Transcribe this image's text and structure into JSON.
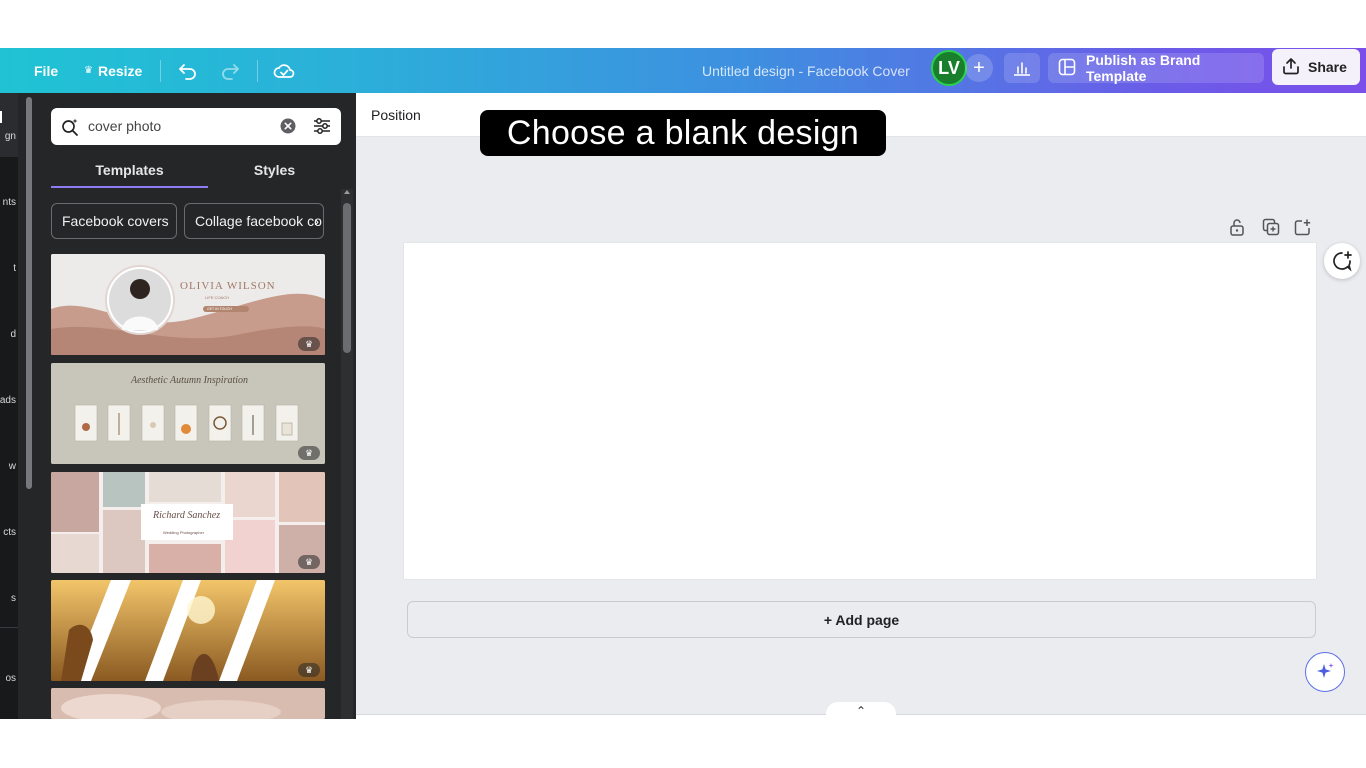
{
  "topbar": {
    "file_label": "File",
    "resize_label": "Resize",
    "design_title": "Untitled design - Facebook Cover",
    "avatar_initials": "LV",
    "add_person_glyph": "+",
    "publish_label": "Publish as Brand Template",
    "share_label": "Share"
  },
  "rail": {
    "items": [
      "gn",
      "nts",
      "t",
      "d",
      "ads",
      "w",
      "cts",
      "s",
      "os"
    ]
  },
  "panel": {
    "search_value": "cover photo",
    "tabs": [
      "Templates",
      "Styles"
    ],
    "active_tab": "Templates",
    "chips": [
      "Facebook covers",
      "Collage facebook co"
    ],
    "templates": [
      {
        "name": "OLIVIA WILSON",
        "subtitle": "LIFE COACH",
        "button": "GET IN TOUCH",
        "premium": true
      },
      {
        "name": "Aesthetic Autumn Inspiration",
        "premium": true
      },
      {
        "name": "Richard Sanchez",
        "subtitle": "Wedding Photographer",
        "premium": true
      },
      {
        "name": "",
        "premium": true
      },
      {
        "name": "",
        "premium": false
      }
    ]
  },
  "editor": {
    "toolbar_label": "Position",
    "callout_text": "Choose a blank design",
    "add_page_label": "+ Add page"
  },
  "colors": {
    "topbar_start": "#1fc3d4",
    "topbar_end": "#7b4fea",
    "panel_bg": "#252627",
    "workspace_bg": "#ebecf0",
    "tab_accent": "#8b7cf6",
    "avatar_bg": "#1a7f2c"
  },
  "icons": [
    "crown-icon",
    "undo-icon",
    "redo-icon",
    "cloud-save-icon",
    "analytics-icon",
    "brand-template-icon",
    "share-icon",
    "search-magic-icon",
    "clear-icon",
    "filter-icon",
    "lock-icon",
    "duplicate-icon",
    "add-page-icon",
    "comment-add-icon",
    "magic-sparkle-icon",
    "chevron-up-icon",
    "chevron-left-icon"
  ]
}
